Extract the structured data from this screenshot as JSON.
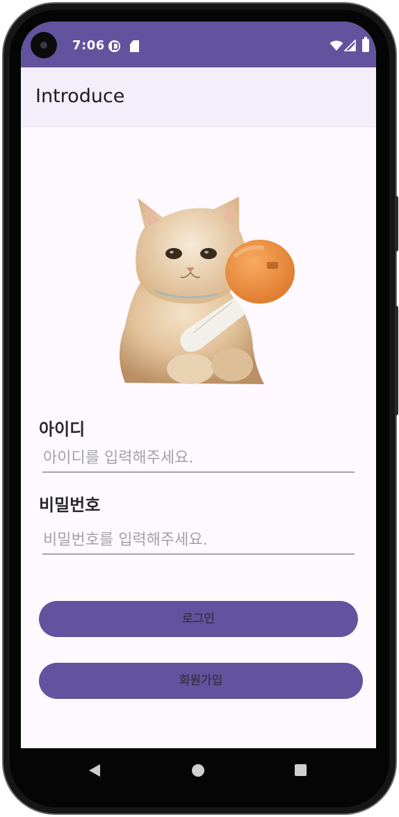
{
  "status_bar": {
    "time": "7:06",
    "icons": [
      "camera-cutout",
      "data-saver-icon",
      "sd-card-icon",
      "wifi-icon",
      "signal-icon",
      "battery-icon"
    ],
    "background_color": "#63539e"
  },
  "app_bar": {
    "title": "Introduce",
    "background_color": "#f3eef9"
  },
  "profile_image": {
    "subject": "fluffy cream cat holding an orange chicken-drumstick plush toy"
  },
  "form": {
    "id_label": "아이디",
    "id_placeholder": "아이디를 입력해주세요.",
    "password_label": "비밀번호",
    "password_placeholder": "비밀번호를 입력해주세요."
  },
  "buttons": {
    "login_label": "로그인",
    "signup_label": "회원가입",
    "color": "#63539e"
  },
  "nav_bar": {
    "icons": [
      "back-icon",
      "home-icon",
      "recents-icon"
    ]
  }
}
